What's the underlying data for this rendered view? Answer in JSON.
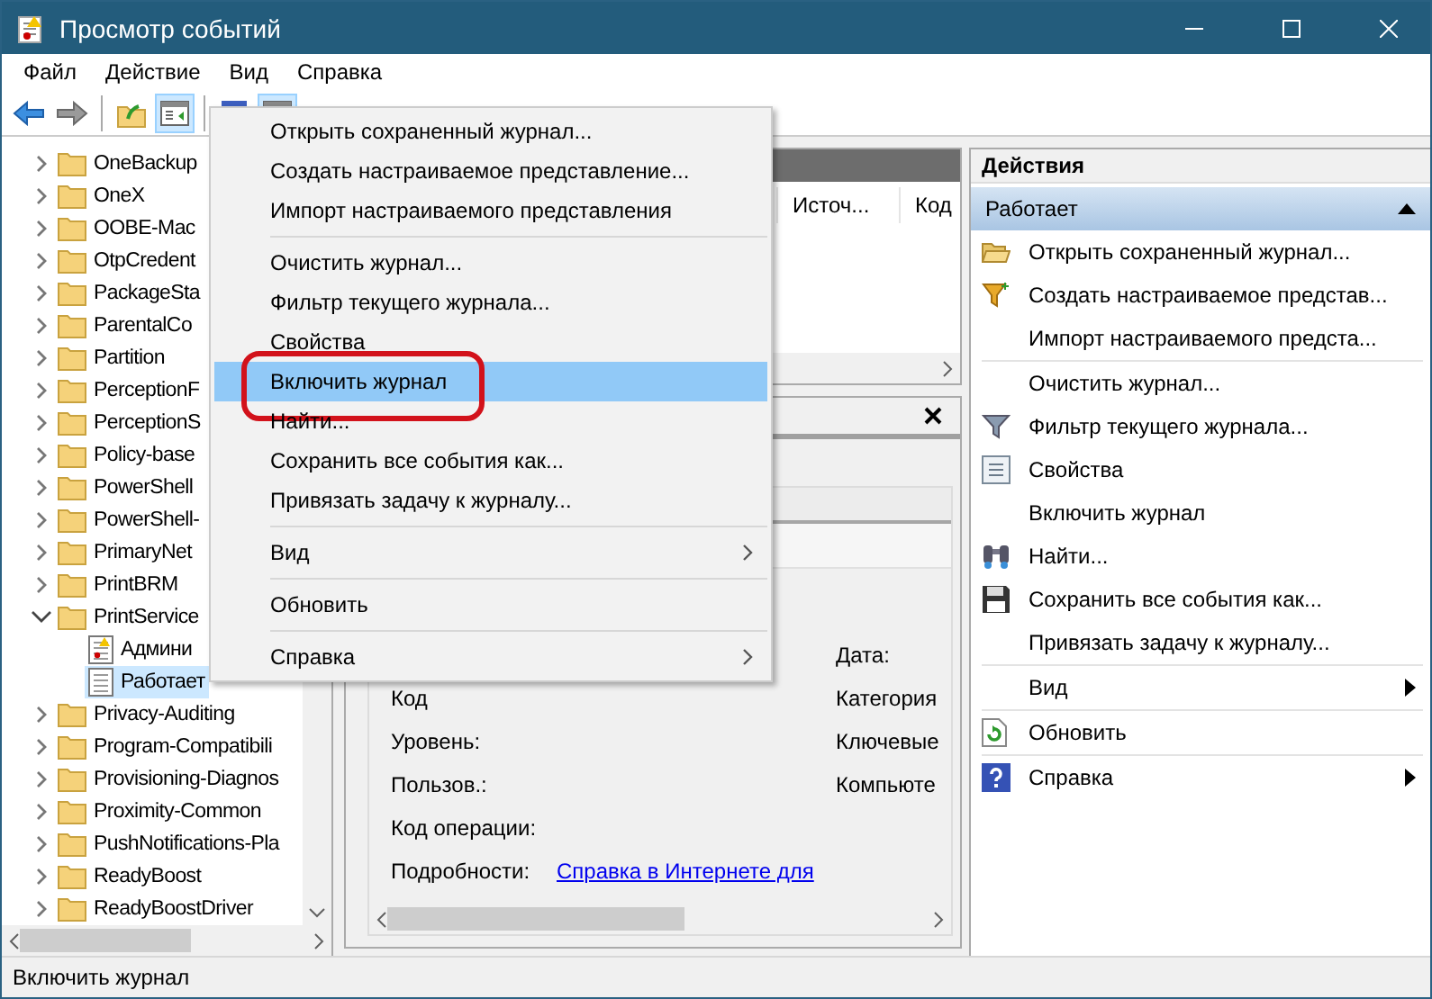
{
  "window": {
    "title": "Просмотр событий"
  },
  "menu_bar": [
    "Файл",
    "Действие",
    "Вид",
    "Справка"
  ],
  "toolbar": [
    {
      "kind": "back",
      "pressed": false
    },
    {
      "kind": "forward",
      "pressed": false
    },
    {
      "kind": "separator"
    },
    {
      "kind": "folder-up",
      "pressed": false
    },
    {
      "kind": "panel",
      "pressed": true
    },
    {
      "kind": "separator"
    },
    {
      "kind": "help",
      "pressed": false
    },
    {
      "kind": "panel",
      "pressed": true
    }
  ],
  "tree": {
    "items": [
      {
        "label": "OneBackup",
        "expanded": false
      },
      {
        "label": "OneX",
        "expanded": false
      },
      {
        "label": "OOBE-Mac",
        "expanded": false
      },
      {
        "label": "OtpCredent",
        "expanded": false
      },
      {
        "label": "PackageSta",
        "expanded": false
      },
      {
        "label": "ParentalCo",
        "expanded": false
      },
      {
        "label": "Partition",
        "expanded": false
      },
      {
        "label": "PerceptionF",
        "expanded": false
      },
      {
        "label": "PerceptionS",
        "expanded": false
      },
      {
        "label": "Policy-base",
        "expanded": false
      },
      {
        "label": "PowerShell",
        "expanded": false
      },
      {
        "label": "PowerShell-",
        "expanded": false
      },
      {
        "label": "PrimaryNet",
        "expanded": false
      },
      {
        "label": "PrintBRM",
        "expanded": false
      },
      {
        "label": "PrintService",
        "expanded": true,
        "children": [
          {
            "label": "Админи",
            "kind": "admin-log",
            "selected": false
          },
          {
            "label": "Работает",
            "kind": "log",
            "selected": true
          }
        ]
      },
      {
        "label": "Privacy-Auditing",
        "expanded": false
      },
      {
        "label": "Program-Compatibili",
        "expanded": false
      },
      {
        "label": "Provisioning-Diagnos",
        "expanded": false
      },
      {
        "label": "Proximity-Common",
        "expanded": false
      },
      {
        "label": "PushNotifications-Pla",
        "expanded": false
      },
      {
        "label": "ReadyBoost",
        "expanded": false
      },
      {
        "label": "ReadyBoostDriver",
        "expanded": false
      }
    ]
  },
  "event_list": {
    "columns": [
      "Источ...",
      "Код"
    ]
  },
  "details": {
    "rows": [
      {
        "right": "Дата:"
      },
      {
        "label": "Код",
        "right": "Категория"
      },
      {
        "label": "Уровень:",
        "right": "Ключевые"
      },
      {
        "label": "Пользов.:",
        "right": "Компьюте"
      },
      {
        "label": "Код операции:"
      },
      {
        "label": "Подробности:",
        "link": "Справка в Интернете для"
      }
    ]
  },
  "context_menu": [
    {
      "kind": "item",
      "label": "Открыть сохраненный журнал...",
      "selected": false,
      "submenu": false,
      "outlined": false
    },
    {
      "kind": "item",
      "label": "Создать настраиваемое представление...",
      "selected": false,
      "submenu": false,
      "outlined": false
    },
    {
      "kind": "item",
      "label": "Импорт настраиваемого представления",
      "selected": false,
      "submenu": false,
      "outlined": false
    },
    {
      "kind": "separator"
    },
    {
      "kind": "item",
      "label": "Очистить журнал...",
      "selected": false,
      "submenu": false,
      "outlined": false
    },
    {
      "kind": "item",
      "label": "Фильтр текущего журнала...",
      "selected": false,
      "submenu": false,
      "outlined": false
    },
    {
      "kind": "item",
      "label": "Свойства",
      "selected": false,
      "submenu": false,
      "outlined": false
    },
    {
      "kind": "item",
      "label": "Включить журнал",
      "selected": true,
      "submenu": false,
      "outlined": true
    },
    {
      "kind": "item",
      "label": "Найти...",
      "selected": false,
      "submenu": false,
      "outlined": false
    },
    {
      "kind": "item",
      "label": "Сохранить все события как...",
      "selected": false,
      "submenu": false,
      "outlined": false
    },
    {
      "kind": "item",
      "label": "Привязать задачу к журналу...",
      "selected": false,
      "submenu": false,
      "outlined": false
    },
    {
      "kind": "separator"
    },
    {
      "kind": "item",
      "label": "Вид",
      "selected": false,
      "submenu": true,
      "outlined": false
    },
    {
      "kind": "separator"
    },
    {
      "kind": "item",
      "label": "Обновить",
      "selected": false,
      "submenu": false,
      "outlined": false
    },
    {
      "kind": "separator"
    },
    {
      "kind": "item",
      "label": "Справка",
      "selected": false,
      "submenu": true,
      "outlined": false
    }
  ],
  "actions": {
    "title": "Действия",
    "section": {
      "label": "Работает",
      "expanded": true
    },
    "items": [
      {
        "kind": "open-folder",
        "label": "Открыть сохраненный журнал...",
        "submenu": false
      },
      {
        "kind": "filter-add",
        "label": "Создать настраиваемое представ...",
        "submenu": false
      },
      {
        "kind": "plain",
        "label": "Импорт настраиваемого предста...",
        "submenu": false
      },
      {
        "kind": "separator"
      },
      {
        "kind": "plain",
        "label": "Очистить журнал...",
        "submenu": false
      },
      {
        "kind": "filter",
        "label": "Фильтр текущего журнала...",
        "submenu": false
      },
      {
        "kind": "properties",
        "label": "Свойства",
        "submenu": false
      },
      {
        "kind": "plain",
        "label": "Включить журнал",
        "submenu": false
      },
      {
        "kind": "binoculars",
        "label": "Найти...",
        "submenu": false
      },
      {
        "kind": "save",
        "label": "Сохранить все события как...",
        "submenu": false
      },
      {
        "kind": "plain",
        "label": "Привязать задачу к журналу...",
        "submenu": false
      },
      {
        "kind": "separator"
      },
      {
        "kind": "plain",
        "label": "Вид",
        "submenu": true
      },
      {
        "kind": "separator"
      },
      {
        "kind": "refresh",
        "label": "Обновить",
        "submenu": false
      },
      {
        "kind": "separator"
      },
      {
        "kind": "help",
        "label": "Справка",
        "submenu": true
      }
    ]
  },
  "status_bar": "Включить журнал"
}
